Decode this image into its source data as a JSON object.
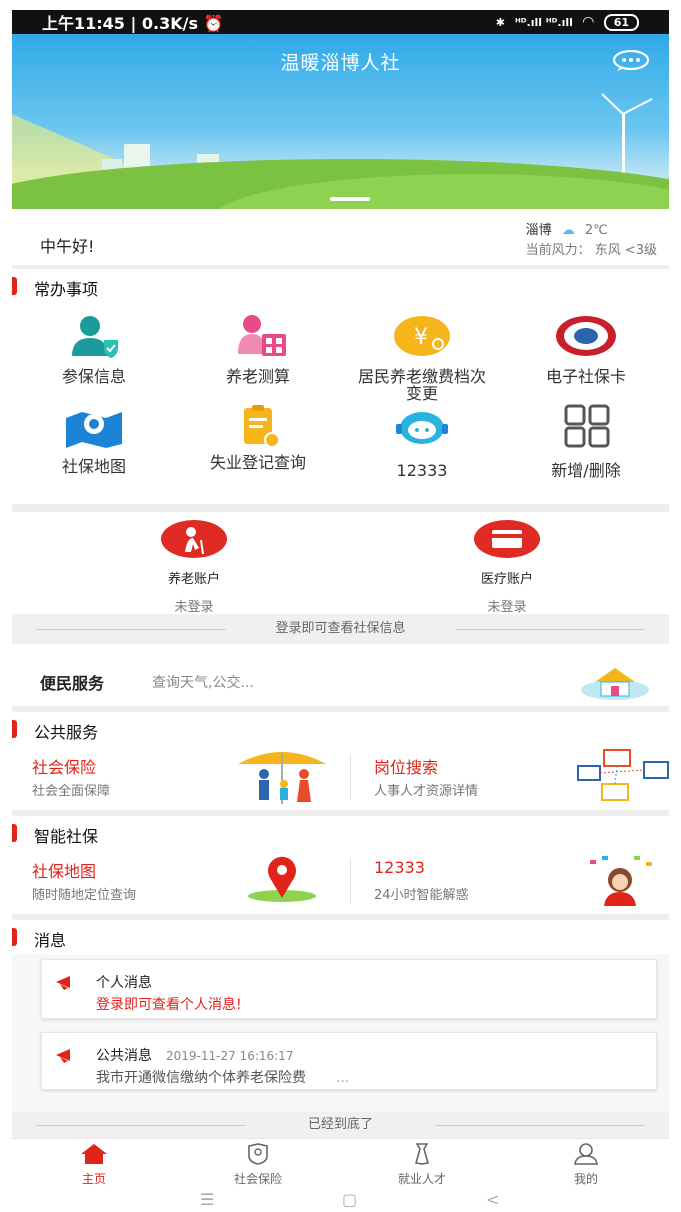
{
  "statusbar": {
    "time": "上午11:45 | 0.3K/s",
    "alarm": "⏰",
    "signal": "ᴴᴰ.ıll ᴴᴰ.ıll",
    "battery": "61"
  },
  "banner": {
    "title": "温暖淄博人社"
  },
  "greeting": {
    "hello": "中午好!",
    "city": "淄博",
    "temp": "2℃",
    "wind": "当前风力：  东风 <3级"
  },
  "common": {
    "title": "常办事项",
    "items": [
      {
        "label": "参保信息"
      },
      {
        "label": "养老测算"
      },
      {
        "label": "居民养老缴费档次变更"
      },
      {
        "label": "电子社保卡"
      },
      {
        "label": "社保地图"
      },
      {
        "label": "失业登记查询"
      },
      {
        "label": "12333"
      },
      {
        "label": "新增/删除"
      }
    ]
  },
  "accounts": [
    {
      "name": "养老账户",
      "status": "未登录"
    },
    {
      "name": "医疗账户",
      "status": "未登录"
    }
  ],
  "login_hint": "登录即可查看社保信息",
  "convenience": {
    "title": "便民服务",
    "desc": "查询天气,公交..."
  },
  "public": {
    "title": "公共服务",
    "cards": [
      {
        "title": "社会保险",
        "sub": "社会全面保障"
      },
      {
        "title": "岗位搜索",
        "sub": "人事人才资源详情"
      }
    ]
  },
  "smart": {
    "title": "智能社保",
    "cards": [
      {
        "title": "社保地图",
        "sub": "随时随地定位查询"
      },
      {
        "title": "12333",
        "sub": "24小时智能解惑"
      }
    ]
  },
  "messages": {
    "title": "消息",
    "personal": {
      "title": "个人消息",
      "body": "登录即可查看个人消息!"
    },
    "public": {
      "title": "公共消息",
      "time": "2019-11-27 16:16:17",
      "body": "我市开通微信缴纳个体养老保险费",
      "more": "..."
    }
  },
  "end_hint": "已经到底了",
  "tabs": [
    {
      "label": "主页"
    },
    {
      "label": "社会保险"
    },
    {
      "label": "就业人才"
    },
    {
      "label": "我的"
    }
  ],
  "colors": {
    "accent": "#e2231a",
    "teal": "#1b9b9b",
    "blue": "#1c84d6",
    "yellow": "#f6b51a"
  }
}
